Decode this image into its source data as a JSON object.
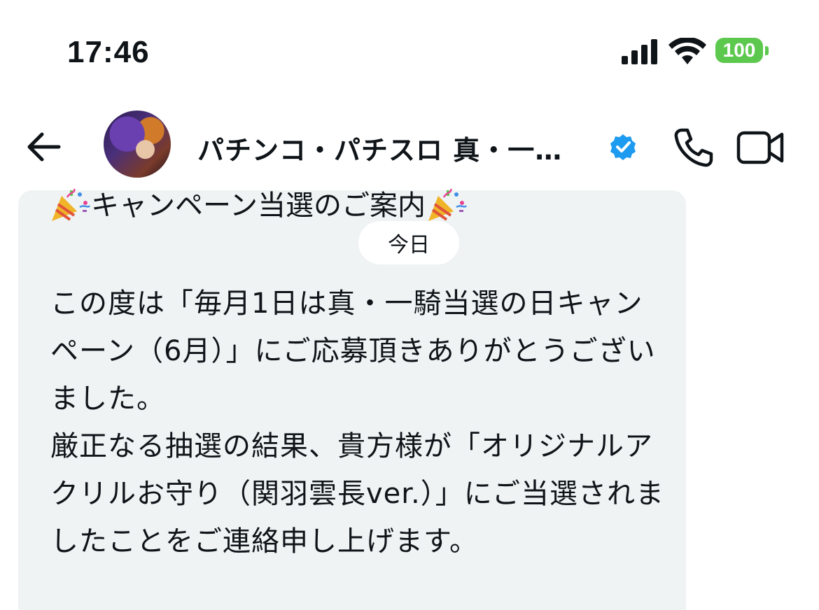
{
  "status_bar": {
    "time": "17:46",
    "battery": "100",
    "battery_color": "#5dc84e"
  },
  "header": {
    "title": "パチンコ・パチスロ 真・一…",
    "verified_color": "#1d9bf0"
  },
  "message": {
    "title_emoji": "🎉",
    "title": "キャンペーン当選のご案内",
    "date_label": "今日",
    "lines": [
      "この度は「毎月1日は真・一騎当選の日キャンペーン（6月）」にご応募頂きありがとうございました。",
      "厳正なる抽選の結果、貴方様が「オリジナルアクリルお守り（関羽雲長ver.）」にご当選されましたことをご連絡申し上げます。"
    ]
  },
  "icons": {
    "back": "arrow-left-icon",
    "call": "phone-icon",
    "video": "video-camera-icon",
    "verified": "verified-badge-icon"
  }
}
